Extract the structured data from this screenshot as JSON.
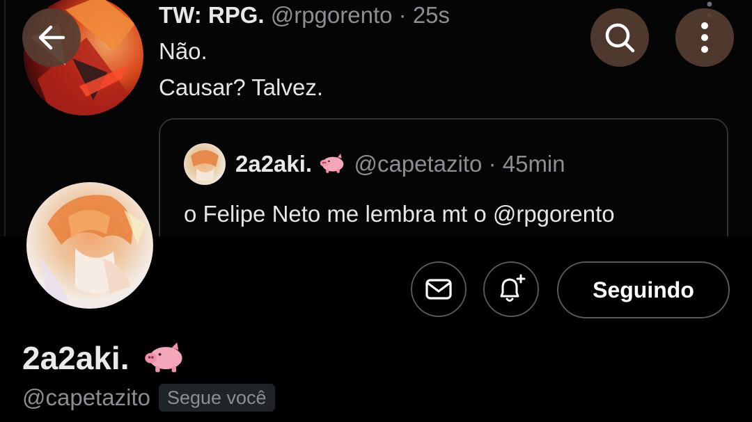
{
  "banner": {
    "tweet": {
      "author_name": "TW: RPG.",
      "handle": "@rpgorento",
      "separator": "·",
      "time": "25s",
      "lines": [
        "Não.",
        "Causar? Talvez."
      ]
    },
    "quote": {
      "author_name": "2a2aki.",
      "handle": "@capetazito",
      "separator": "·",
      "time": "45min",
      "text": "o Felipe Neto me lembra mt o @rpgorento"
    }
  },
  "toolbar": {
    "back_icon": "arrow-left-icon",
    "search_icon": "search-icon",
    "more_icon": "more-vertical-icon"
  },
  "profile": {
    "display_name": "2a2aki.",
    "handle": "@capetazito",
    "follows_you": "Segue você",
    "following_label": "Seguindo",
    "message_icon": "mail-icon",
    "notify_icon": "bell-plus-icon"
  },
  "colors": {
    "background": "#000000",
    "text_primary": "#e8e8e8",
    "text_secondary": "#8b8f93",
    "border": "#53595e",
    "overlay_button": "#563e32",
    "pig_emoji": "#f4a7b9"
  }
}
